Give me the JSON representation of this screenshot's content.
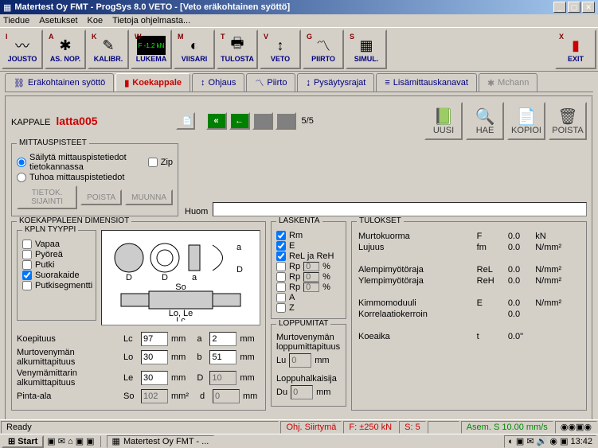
{
  "window": {
    "title": "Matertest Oy   FMT - ProgSys 8.0 VETO - [Veto eräkohtainen syöttö]"
  },
  "menu": {
    "items": [
      "Tiedue",
      "Asetukset",
      "Koe",
      "Tietoja ohjelmasta..."
    ]
  },
  "toolbar": [
    {
      "key": "I",
      "label": "JOUSTO",
      "icon": "〰"
    },
    {
      "key": "A",
      "label": "AS. NOP.",
      "icon": "✱"
    },
    {
      "key": "K",
      "label": "KALIBR.",
      "icon": "✎"
    },
    {
      "key": "W",
      "label": "LUKEMA",
      "icon": "F -1.2 kN"
    },
    {
      "key": "M",
      "label": "VIISARI",
      "icon": "◐"
    },
    {
      "key": "T",
      "label": "TULOSTA",
      "icon": "🖶"
    },
    {
      "key": "V",
      "label": "VETO",
      "icon": "↕"
    },
    {
      "key": "G",
      "label": "PIIRTO",
      "icon": "〽"
    },
    {
      "key": "S",
      "label": "SIMUL.",
      "icon": "▦"
    }
  ],
  "exit_btn": {
    "key": "X",
    "label": "EXIT"
  },
  "tabs": [
    {
      "label": "Eräkohtainen syöttö",
      "active": false
    },
    {
      "label": "Koekappale",
      "active": true
    },
    {
      "label": "Ohjaus",
      "active": false
    },
    {
      "label": "Piirto",
      "active": false
    },
    {
      "label": "Pysäytysrajat",
      "active": false
    },
    {
      "label": "Lisämittauskanavat",
      "active": false
    },
    {
      "label": "Mchann",
      "active": false,
      "disabled": true
    }
  ],
  "kappale": {
    "label": "KAPPALE",
    "value": "latta005"
  },
  "pager": "5/5",
  "action_buttons": [
    {
      "label": "UUSI",
      "icon": "📗"
    },
    {
      "label": "HAE",
      "icon": "🔍"
    },
    {
      "label": "KOPIOI",
      "icon": "📄"
    },
    {
      "label": "POISTA",
      "icon": "🗑"
    }
  ],
  "mittaus": {
    "legend": "MITTAUSPISTEET",
    "opt1": "Säilytä mittauspistetiedot tietokannassa",
    "zip": "Zip",
    "opt2": "Tuhoa mittauspistetiedot",
    "btns": [
      "TIETOK. SIJAINTI",
      "POISTA",
      "MUUNNA"
    ]
  },
  "huom": {
    "label": "Huom",
    "value": ""
  },
  "dim": {
    "legend": "KOEKAPPALEEN DIMENSIOT",
    "types_legend": "KPLN TYYPPI",
    "types": [
      "Vapaa",
      "Pyöreä",
      "Putki",
      "Suorakaide",
      "Putkisegmentti"
    ],
    "selected_type": "Suorakaide",
    "rows": [
      {
        "label": "Koepituus",
        "sym": "Lc",
        "val": "97",
        "u": "mm",
        "sym2": "a",
        "val2": "2",
        "u2": "mm"
      },
      {
        "label": "Murtovenymän alkumittapituus",
        "sym": "Lo",
        "val": "30",
        "u": "mm",
        "sym2": "b",
        "val2": "51",
        "u2": "mm"
      },
      {
        "label": "Venymämittarin alkumittapituus",
        "sym": "Le",
        "val": "30",
        "u": "mm",
        "sym2": "D",
        "val2": "10",
        "u2": "mm",
        "ro2": true
      },
      {
        "label": "Pinta-ala",
        "sym": "So",
        "val": "102",
        "u": "mm²",
        "sym2": "d",
        "val2": "0",
        "u2": "mm",
        "ro": true,
        "ro2": true
      }
    ]
  },
  "lask": {
    "legend": "LASKENTA",
    "items": [
      {
        "label": "Rm",
        "checked": true,
        "pct": false
      },
      {
        "label": "E",
        "checked": true,
        "pct": false
      },
      {
        "label": "ReL ja ReH",
        "checked": true,
        "pct": false
      },
      {
        "label": "Rp",
        "checked": false,
        "pct": true,
        "pval": "0"
      },
      {
        "label": "Rp",
        "checked": false,
        "pct": true,
        "pval": "0"
      },
      {
        "label": "Rp",
        "checked": false,
        "pct": true,
        "pval": "0"
      },
      {
        "label": "A",
        "checked": false,
        "pct": false
      },
      {
        "label": "Z",
        "checked": false,
        "pct": false
      }
    ]
  },
  "loppu": {
    "legend": "LOPPUMITAT",
    "l1": "Murtovenymän",
    "l2": "loppumittapituus",
    "lu_label": "Lu",
    "lu_val": "0",
    "lu_u": "mm",
    "dl": "Loppuhalkaisija",
    "du_label": "Du",
    "du_val": "0",
    "du_u": "mm"
  },
  "tulokset": {
    "legend": "TULOKSET",
    "rows": [
      {
        "n": "Murtokuorma",
        "s": "F",
        "v": "0.0",
        "u": "kN"
      },
      {
        "n": "Lujuus",
        "s": "fm",
        "v": "0.0",
        "u": "N/mm²"
      },
      {
        "n": "",
        "s": "",
        "v": "",
        "u": ""
      },
      {
        "n": "Alempimyötöraja",
        "s": "ReL",
        "v": "0.0",
        "u": "N/mm²"
      },
      {
        "n": "Ylempimyötöraja",
        "s": "ReH",
        "v": "0.0",
        "u": "N/mm²"
      },
      {
        "n": "",
        "s": "",
        "v": "",
        "u": ""
      },
      {
        "n": "Kimmomoduuli",
        "s": "E",
        "v": "0.0",
        "u": "N/mm²"
      },
      {
        "n": "Korrelaatiokerroin",
        "s": "",
        "v": "0.0",
        "u": ""
      },
      {
        "n": "",
        "s": "",
        "v": "",
        "u": ""
      },
      {
        "n": "Koeaika",
        "s": "t",
        "v": "0.0\"",
        "u": ""
      }
    ]
  },
  "status": {
    "ready": "Ready",
    "a": "Ohj. Siirtymä",
    "b": "F: ±250 kN",
    "c": "S: 5",
    "d": "",
    "e": "Asem. S 10.00 mm/s"
  },
  "taskbar": {
    "start": "Start",
    "task": "Matertest Oy   FMT - ...",
    "clock": "13:42"
  }
}
